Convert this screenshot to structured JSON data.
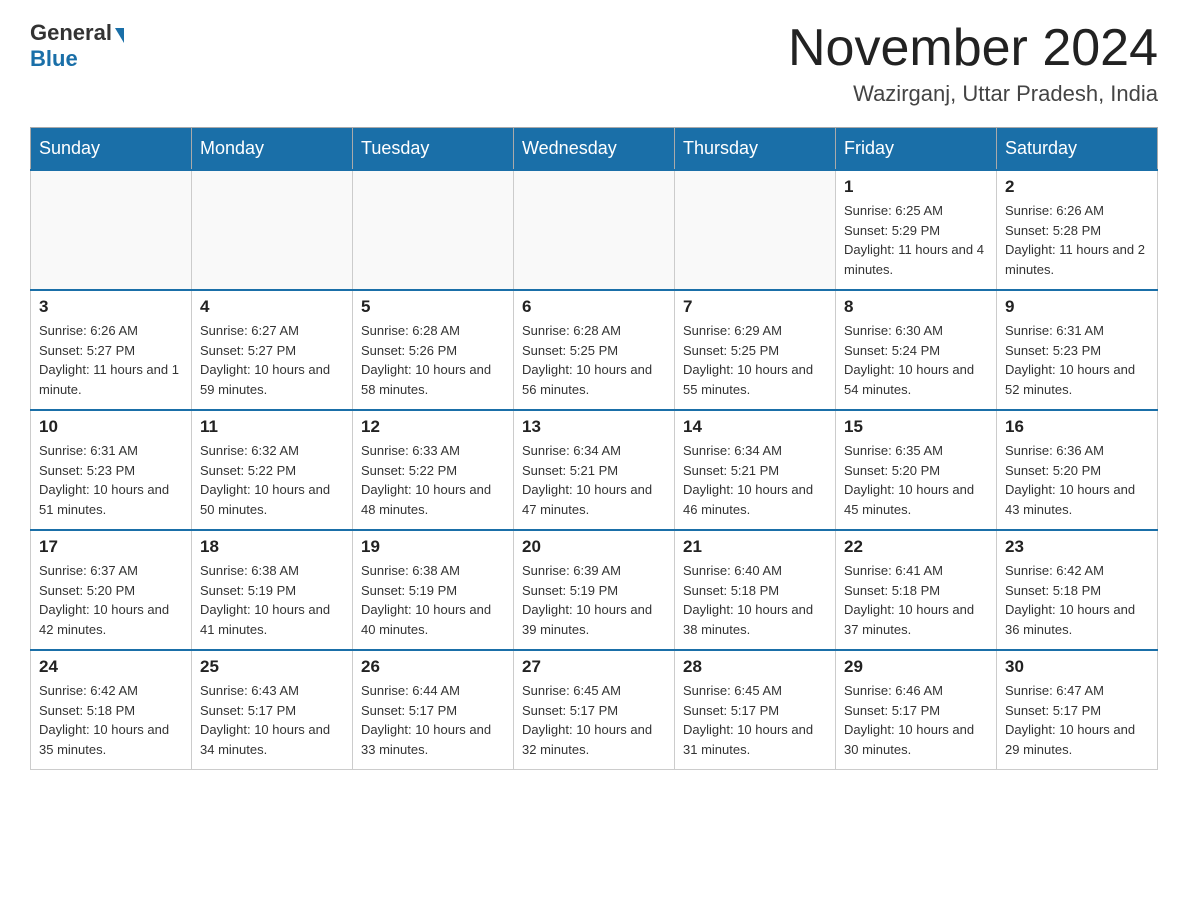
{
  "header": {
    "logo_general": "General",
    "logo_blue": "Blue",
    "month_title": "November 2024",
    "location": "Wazirganj, Uttar Pradesh, India"
  },
  "days_of_week": [
    "Sunday",
    "Monday",
    "Tuesday",
    "Wednesday",
    "Thursday",
    "Friday",
    "Saturday"
  ],
  "weeks": [
    {
      "days": [
        {
          "num": "",
          "info": ""
        },
        {
          "num": "",
          "info": ""
        },
        {
          "num": "",
          "info": ""
        },
        {
          "num": "",
          "info": ""
        },
        {
          "num": "",
          "info": ""
        },
        {
          "num": "1",
          "info": "Sunrise: 6:25 AM\nSunset: 5:29 PM\nDaylight: 11 hours and 4 minutes."
        },
        {
          "num": "2",
          "info": "Sunrise: 6:26 AM\nSunset: 5:28 PM\nDaylight: 11 hours and 2 minutes."
        }
      ]
    },
    {
      "days": [
        {
          "num": "3",
          "info": "Sunrise: 6:26 AM\nSunset: 5:27 PM\nDaylight: 11 hours and 1 minute."
        },
        {
          "num": "4",
          "info": "Sunrise: 6:27 AM\nSunset: 5:27 PM\nDaylight: 10 hours and 59 minutes."
        },
        {
          "num": "5",
          "info": "Sunrise: 6:28 AM\nSunset: 5:26 PM\nDaylight: 10 hours and 58 minutes."
        },
        {
          "num": "6",
          "info": "Sunrise: 6:28 AM\nSunset: 5:25 PM\nDaylight: 10 hours and 56 minutes."
        },
        {
          "num": "7",
          "info": "Sunrise: 6:29 AM\nSunset: 5:25 PM\nDaylight: 10 hours and 55 minutes."
        },
        {
          "num": "8",
          "info": "Sunrise: 6:30 AM\nSunset: 5:24 PM\nDaylight: 10 hours and 54 minutes."
        },
        {
          "num": "9",
          "info": "Sunrise: 6:31 AM\nSunset: 5:23 PM\nDaylight: 10 hours and 52 minutes."
        }
      ]
    },
    {
      "days": [
        {
          "num": "10",
          "info": "Sunrise: 6:31 AM\nSunset: 5:23 PM\nDaylight: 10 hours and 51 minutes."
        },
        {
          "num": "11",
          "info": "Sunrise: 6:32 AM\nSunset: 5:22 PM\nDaylight: 10 hours and 50 minutes."
        },
        {
          "num": "12",
          "info": "Sunrise: 6:33 AM\nSunset: 5:22 PM\nDaylight: 10 hours and 48 minutes."
        },
        {
          "num": "13",
          "info": "Sunrise: 6:34 AM\nSunset: 5:21 PM\nDaylight: 10 hours and 47 minutes."
        },
        {
          "num": "14",
          "info": "Sunrise: 6:34 AM\nSunset: 5:21 PM\nDaylight: 10 hours and 46 minutes."
        },
        {
          "num": "15",
          "info": "Sunrise: 6:35 AM\nSunset: 5:20 PM\nDaylight: 10 hours and 45 minutes."
        },
        {
          "num": "16",
          "info": "Sunrise: 6:36 AM\nSunset: 5:20 PM\nDaylight: 10 hours and 43 minutes."
        }
      ]
    },
    {
      "days": [
        {
          "num": "17",
          "info": "Sunrise: 6:37 AM\nSunset: 5:20 PM\nDaylight: 10 hours and 42 minutes."
        },
        {
          "num": "18",
          "info": "Sunrise: 6:38 AM\nSunset: 5:19 PM\nDaylight: 10 hours and 41 minutes."
        },
        {
          "num": "19",
          "info": "Sunrise: 6:38 AM\nSunset: 5:19 PM\nDaylight: 10 hours and 40 minutes."
        },
        {
          "num": "20",
          "info": "Sunrise: 6:39 AM\nSunset: 5:19 PM\nDaylight: 10 hours and 39 minutes."
        },
        {
          "num": "21",
          "info": "Sunrise: 6:40 AM\nSunset: 5:18 PM\nDaylight: 10 hours and 38 minutes."
        },
        {
          "num": "22",
          "info": "Sunrise: 6:41 AM\nSunset: 5:18 PM\nDaylight: 10 hours and 37 minutes."
        },
        {
          "num": "23",
          "info": "Sunrise: 6:42 AM\nSunset: 5:18 PM\nDaylight: 10 hours and 36 minutes."
        }
      ]
    },
    {
      "days": [
        {
          "num": "24",
          "info": "Sunrise: 6:42 AM\nSunset: 5:18 PM\nDaylight: 10 hours and 35 minutes."
        },
        {
          "num": "25",
          "info": "Sunrise: 6:43 AM\nSunset: 5:17 PM\nDaylight: 10 hours and 34 minutes."
        },
        {
          "num": "26",
          "info": "Sunrise: 6:44 AM\nSunset: 5:17 PM\nDaylight: 10 hours and 33 minutes."
        },
        {
          "num": "27",
          "info": "Sunrise: 6:45 AM\nSunset: 5:17 PM\nDaylight: 10 hours and 32 minutes."
        },
        {
          "num": "28",
          "info": "Sunrise: 6:45 AM\nSunset: 5:17 PM\nDaylight: 10 hours and 31 minutes."
        },
        {
          "num": "29",
          "info": "Sunrise: 6:46 AM\nSunset: 5:17 PM\nDaylight: 10 hours and 30 minutes."
        },
        {
          "num": "30",
          "info": "Sunrise: 6:47 AM\nSunset: 5:17 PM\nDaylight: 10 hours and 29 minutes."
        }
      ]
    }
  ]
}
